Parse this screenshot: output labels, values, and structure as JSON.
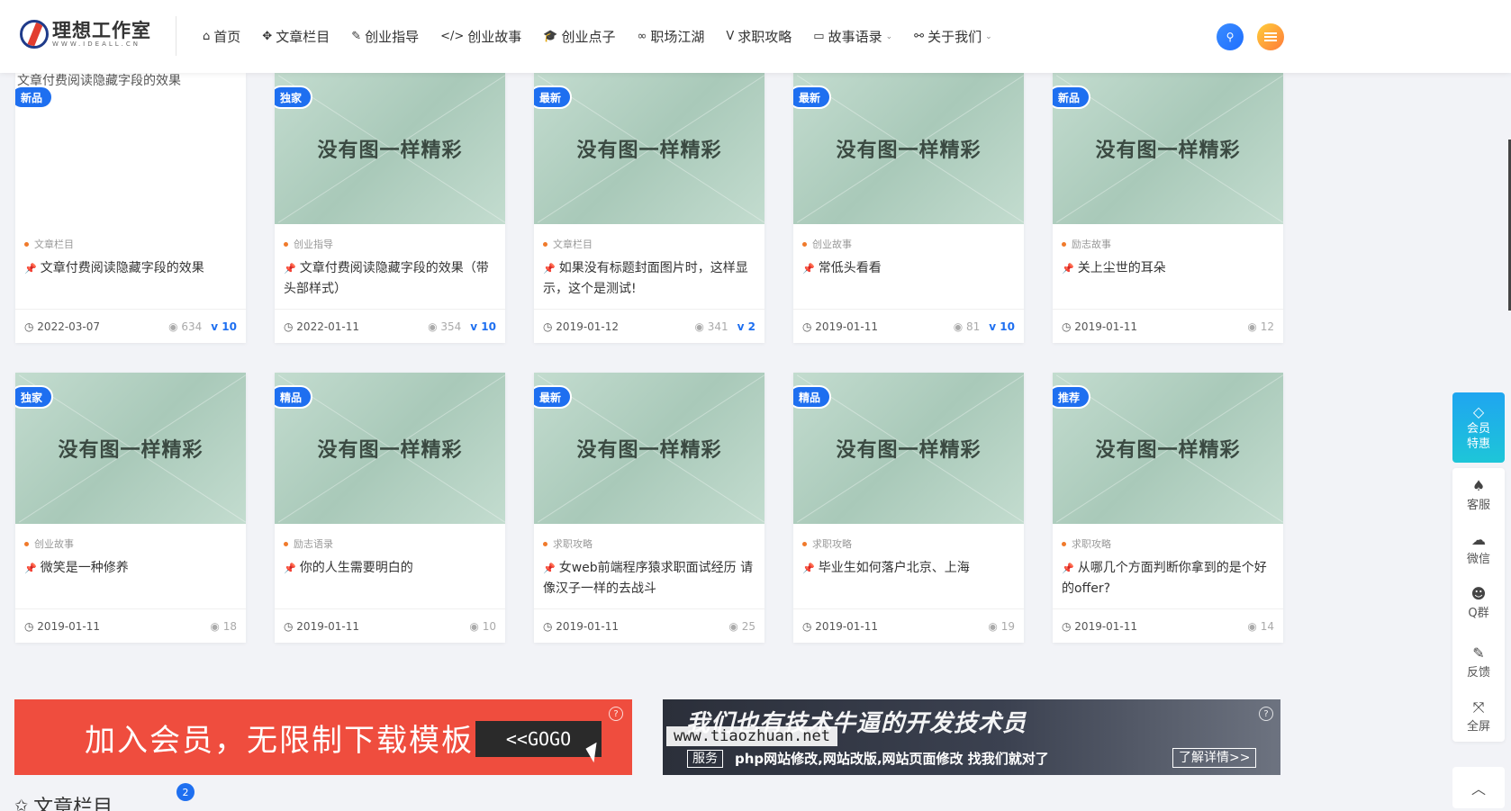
{
  "header": {
    "logo_title": "理想工作室",
    "logo_sub": "WWW.IDEALL.CN",
    "nav": [
      {
        "icon": "home-icon",
        "glyph": "⌂",
        "label": "首页"
      },
      {
        "icon": "articles-icon",
        "glyph": "✥",
        "label": "文章栏目"
      },
      {
        "icon": "guide-icon",
        "glyph": "✎",
        "label": "创业指导"
      },
      {
        "icon": "code-icon",
        "glyph": "</>",
        "label": "创业故事"
      },
      {
        "icon": "graduation-cap-icon",
        "glyph": "🎓",
        "label": "创业点子"
      },
      {
        "icon": "link-icon",
        "glyph": "∞",
        "label": "职场江湖"
      },
      {
        "icon": "v-icon",
        "glyph": "V",
        "label": "求职攻略"
      },
      {
        "icon": "laptop-icon",
        "glyph": "▭",
        "label": "故事语录"
      },
      {
        "icon": "unlink-icon",
        "glyph": "⚯",
        "label": "关于我们"
      }
    ]
  },
  "cards": [
    {
      "badge": "新品",
      "image_alt": "文章付费阅读隐藏字段的效果",
      "category": "文章栏目",
      "title": "文章付费阅读隐藏字段的效果",
      "date": "2022-03-07",
      "views": "634",
      "vip": "10"
    },
    {
      "badge": "独家",
      "placeholder": "没有图一样精彩",
      "category": "创业指导",
      "title": "文章付费阅读隐藏字段的效果（带头部样式）",
      "date": "2022-01-11",
      "views": "354",
      "vip": "10"
    },
    {
      "badge": "最新",
      "placeholder": "没有图一样精彩",
      "category": "文章栏目",
      "title": "如果没有标题封面图片时，这样显示，这个是测试!",
      "date": "2019-01-12",
      "views": "341",
      "vip": "2"
    },
    {
      "badge": "最新",
      "placeholder": "没有图一样精彩",
      "category": "创业故事",
      "title": "常低头看看",
      "date": "2019-01-11",
      "views": "81",
      "vip": "10"
    },
    {
      "badge": "新品",
      "placeholder": "没有图一样精彩",
      "category": "励志故事",
      "title": "关上尘世的耳朵",
      "date": "2019-01-11",
      "views": "12"
    },
    {
      "badge": "独家",
      "placeholder": "没有图一样精彩",
      "category": "创业故事",
      "title": "微笑是一种修养",
      "date": "2019-01-11",
      "views": "18"
    },
    {
      "badge": "精品",
      "placeholder": "没有图一样精彩",
      "category": "励志语录",
      "title": "你的人生需要明白的",
      "date": "2019-01-11",
      "views": "10"
    },
    {
      "badge": "最新",
      "placeholder": "没有图一样精彩",
      "category": "求职攻略",
      "title": "女web前端程序猿求职面试经历 请像汉子一样的去战斗",
      "date": "2019-01-11",
      "views": "25"
    },
    {
      "badge": "精品",
      "placeholder": "没有图一样精彩",
      "category": "求职攻略",
      "title": "毕业生如何落户北京、上海",
      "date": "2019-01-11",
      "views": "19"
    },
    {
      "badge": "推荐",
      "placeholder": "没有图一样精彩",
      "category": "求职攻略",
      "title": "从哪几个方面判断你拿到的是个好的offer?",
      "date": "2019-01-11",
      "views": "14"
    }
  ],
  "banners": {
    "left_text": "加入会员，无限制下载模板",
    "left_button": "<<GOGO",
    "right_headline": "我们也有技术牛逼的开发技术员",
    "right_domain": "www.tiaozhuan.net",
    "right_service": "服务",
    "right_desc": "php网站修改,网站改版,网站页面修改 找我们就对了",
    "right_more": "了解详情>>",
    "ad_mark": "?"
  },
  "section": {
    "title": "文章栏目",
    "badge": "2"
  },
  "float": {
    "vip": "会员特惠",
    "tools": [
      "客服",
      "微信",
      "Q群",
      "反馈",
      "全屏"
    ]
  },
  "colors": {
    "accent": "#1e6ff0",
    "category_dot": "#f07a2b",
    "banner_red": "#ef4d3e"
  }
}
